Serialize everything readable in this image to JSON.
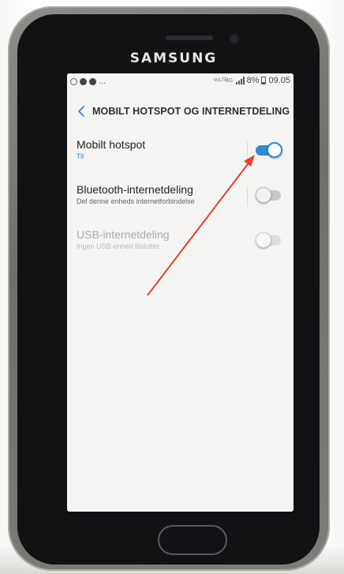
{
  "device": {
    "brand": "SAMSUNG"
  },
  "statusbar": {
    "left_text": "...",
    "volte": "VoLTE",
    "network": "4G",
    "battery_percent": "8%",
    "time": "09.05"
  },
  "header": {
    "back_glyph": "<",
    "title": "MOBILT HOTSPOT OG INTERNETDELING"
  },
  "settings": {
    "items": [
      {
        "title": "Mobilt hotspot",
        "subtitle": "Til",
        "toggle_on": true,
        "enabled": true
      },
      {
        "title": "Bluetooth-internetdeling",
        "subtitle": "Del denne enheds internetforbindelse",
        "toggle_on": false,
        "enabled": true
      },
      {
        "title": "USB-internetdeling",
        "subtitle": "Ingen USB-enhed tilsluttet",
        "toggle_on": false,
        "enabled": false
      }
    ]
  },
  "colors": {
    "accent": "#2f8ad8",
    "annotation_arrow": "#e8412c"
  },
  "icons": {
    "back": "chevron-left-icon",
    "annotation": "red-arrow-icon"
  }
}
